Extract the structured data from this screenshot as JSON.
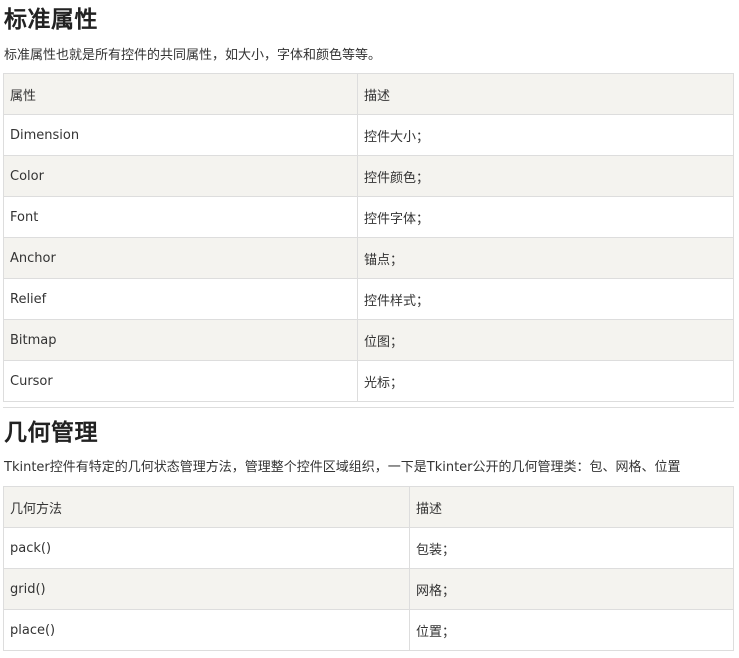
{
  "section_attrs": {
    "title": "标准属性",
    "intro": "标准属性也就是所有控件的共同属性，如大小，字体和颜色等等。",
    "header": [
      "属性",
      "描述"
    ],
    "rows": [
      [
        "Dimension",
        "控件大小；"
      ],
      [
        "Color",
        "控件颜色；"
      ],
      [
        "Font",
        "控件字体；"
      ],
      [
        "Anchor",
        "锚点；"
      ],
      [
        "Relief",
        "控件样式；"
      ],
      [
        "Bitmap",
        "位图；"
      ],
      [
        "Cursor",
        "光标；"
      ]
    ]
  },
  "section_geom": {
    "title": "几何管理",
    "intro": "Tkinter控件有特定的几何状态管理方法，管理整个控件区域组织，一下是Tkinter公开的几何管理类：包、网格、位置",
    "header": [
      "几何方法",
      "描述"
    ],
    "rows": [
      [
        "pack()",
        "包装；"
      ],
      [
        "grid()",
        "网格；"
      ],
      [
        "place()",
        "位置；"
      ]
    ]
  },
  "colors": {
    "header_bg": "#f4f3ef",
    "alt_row_bg": "#f4f3ef",
    "border": "#dddddd",
    "text": "#333333"
  }
}
